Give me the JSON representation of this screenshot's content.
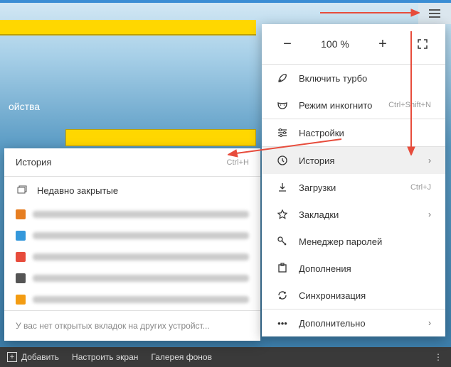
{
  "bg_label": "ойства",
  "zoom": {
    "minus": "−",
    "value": "100 %",
    "plus": "+"
  },
  "menu": {
    "turbo": "Включить турбо",
    "incognito": "Режим инкогнито",
    "incognito_shortcut": "Ctrl+Shift+N",
    "settings": "Настройки",
    "history": "История",
    "downloads": "Загрузки",
    "downloads_shortcut": "Ctrl+J",
    "bookmarks": "Закладки",
    "passwords": "Менеджер паролей",
    "addons": "Дополнения",
    "sync": "Синхронизация",
    "more": "Дополнительно"
  },
  "history_panel": {
    "title": "История",
    "shortcut": "Ctrl+H",
    "recently_closed": "Недавно закрытые",
    "footer": "У вас нет открытых вкладок на других устройст..."
  },
  "bottom": {
    "add": "Добавить",
    "screen": "Настроить экран",
    "backgrounds": "Галерея фонов"
  }
}
